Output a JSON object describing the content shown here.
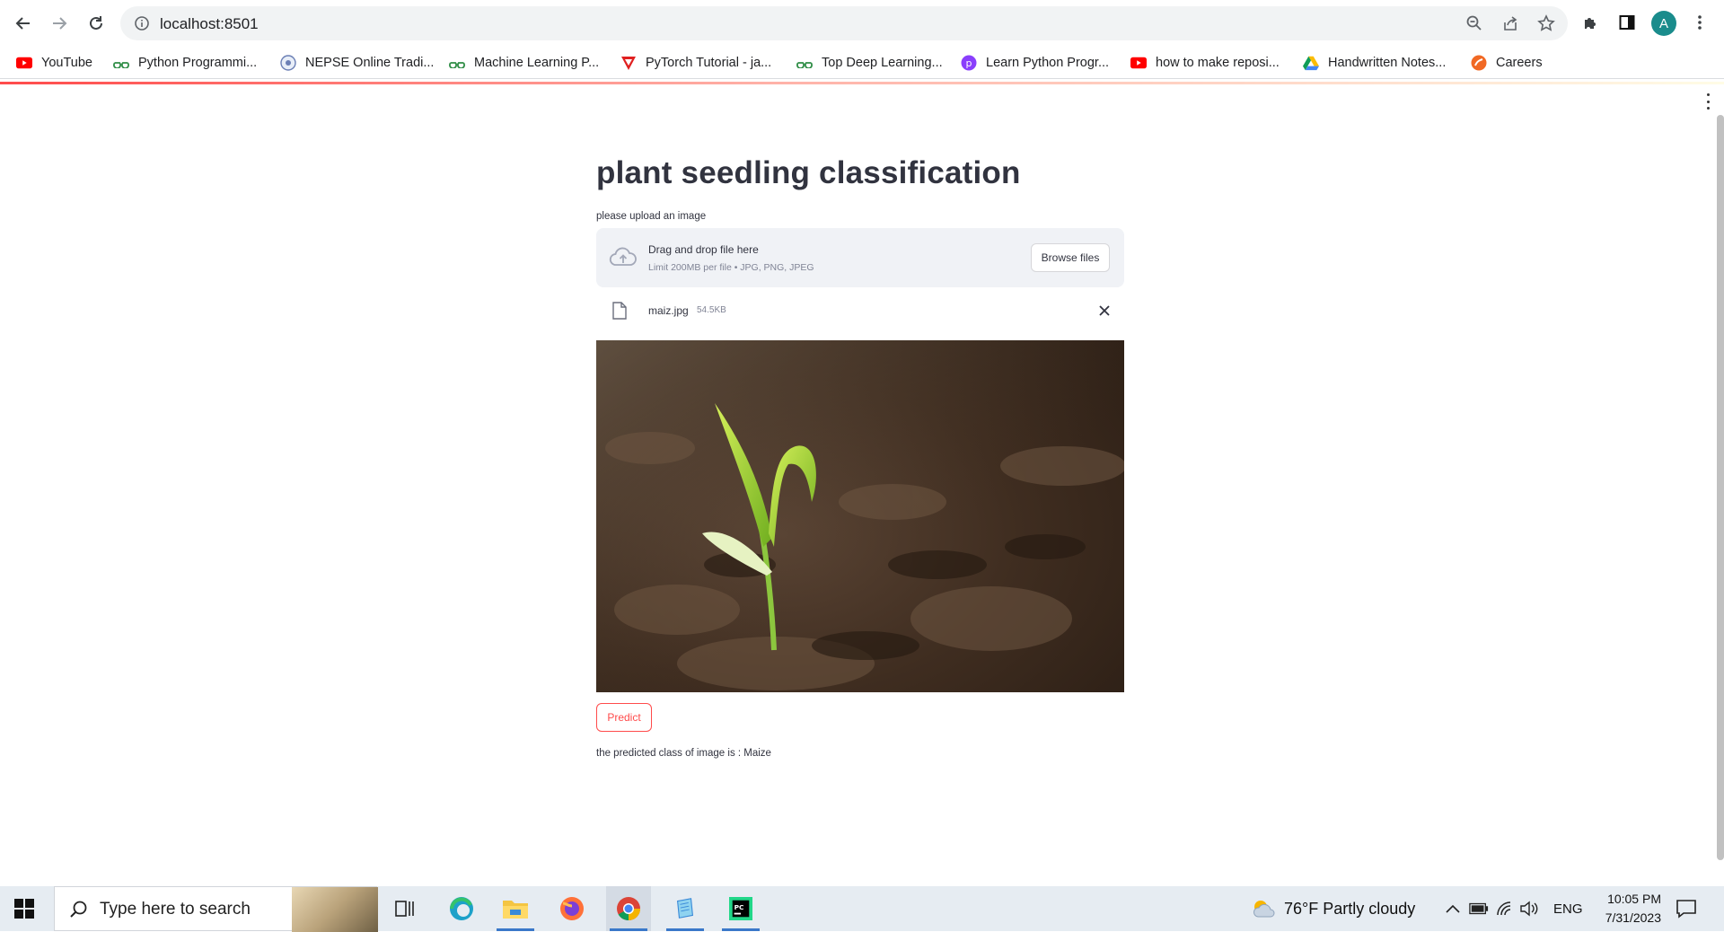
{
  "browser": {
    "url": "localhost:8501",
    "avatar_letter": "A",
    "bookmarks": [
      {
        "label": "YouTube",
        "icon": "youtube-icon"
      },
      {
        "label": "Python Programmi...",
        "icon": "geeksforgeeks-icon"
      },
      {
        "label": "NEPSE Online Tradi...",
        "icon": "nepse-icon"
      },
      {
        "label": "Machine Learning P...",
        "icon": "geeksforgeeks-icon"
      },
      {
        "label": "PyTorch Tutorial - ja...",
        "icon": "javatpoint-icon"
      },
      {
        "label": "Top Deep Learning...",
        "icon": "geeksforgeeks-icon"
      },
      {
        "label": "Learn Python Progr...",
        "icon": "programiz-icon"
      },
      {
        "label": "how to make reposi...",
        "icon": "youtube-icon"
      },
      {
        "label": "Handwritten Notes...",
        "icon": "google-drive-icon"
      },
      {
        "label": "Careers",
        "icon": "careers-icon"
      }
    ]
  },
  "app": {
    "title": "plant seedling classification",
    "uploader": {
      "label": "please upload an image",
      "drop_text": "Drag and drop file here",
      "limit_text": "Limit 200MB per file • JPG, PNG, JPEG",
      "browse_label": "Browse files"
    },
    "file": {
      "name": "maiz.jpg",
      "size": "54.5KB"
    },
    "predict_label": "Predict",
    "result_text": "the predicted class of image is : Maize"
  },
  "taskbar": {
    "search_placeholder": "Type here to search",
    "weather": "76°F  Partly cloudy",
    "language": "ENG",
    "time": "10:05 PM",
    "date": "7/31/2023"
  },
  "colors": {
    "accent": "#ff4b4b",
    "text": "#31333f",
    "dropzone_bg": "#f0f2f6"
  }
}
